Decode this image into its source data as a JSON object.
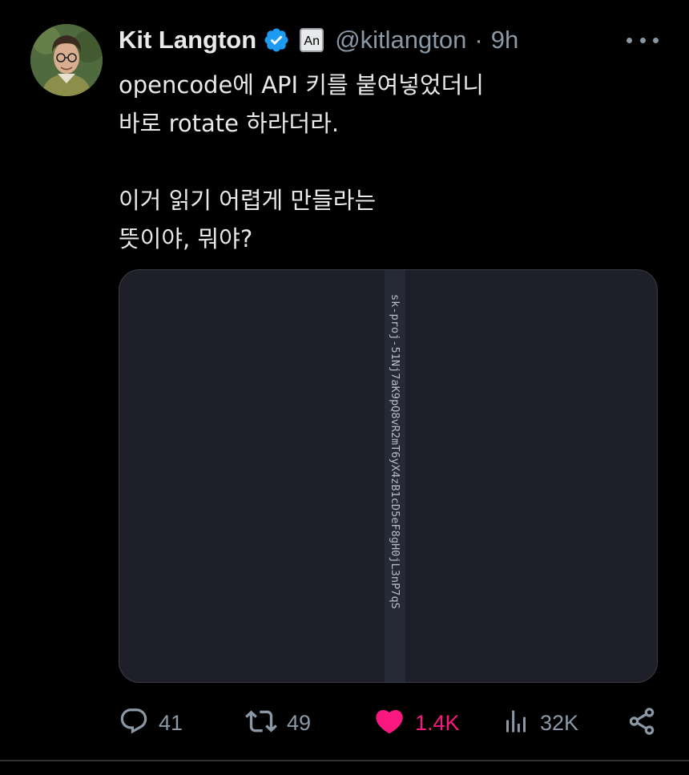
{
  "author": {
    "display_name": "Kit Langton",
    "verified_icon": "verified-badge-icon",
    "label_badge": "An",
    "handle": "@kitlangton",
    "separator": "·",
    "time": "9h"
  },
  "tweet": {
    "text": "opencode에 API 키를 붙여넣었더니\n바로 rotate 하라더라.\n\n이거 읽기 어렵게 만들라는\n뜻이야, 뭐야?"
  },
  "media": {
    "key_text": "sk-proj-51Nj7aK9pQ8vR2mT6yX4zB1cD5eF8gH0jL3nP7qS"
  },
  "actions": {
    "reply_count": "41",
    "repost_count": "49",
    "like_count": "1.4K",
    "views_count": "32K"
  },
  "colors": {
    "background": "#000000",
    "text": "#e7e9ea",
    "secondary": "#8b98a5",
    "verified": "#1d9bf0",
    "like": "#f91880",
    "media_bg": "#1e1f29"
  }
}
